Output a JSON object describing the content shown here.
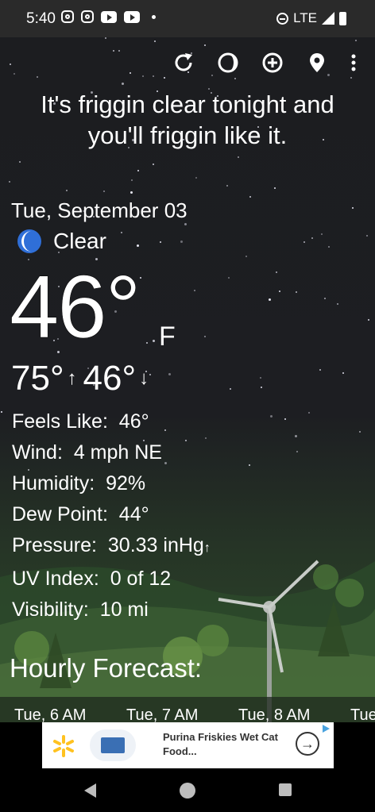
{
  "status_bar": {
    "time": "5:40",
    "network": "LTE",
    "left_icons": [
      "instagram-icon",
      "instagram-icon",
      "youtube-icon",
      "youtube-icon",
      "dot-icon"
    ],
    "right_icons": [
      "do-not-disturb-icon",
      "signal-icon",
      "battery-icon"
    ]
  },
  "toolbar": {
    "icons": [
      "refresh-icon",
      "moon-phase-icon",
      "add-location-icon",
      "location-pin-icon",
      "more-vert-icon"
    ]
  },
  "headline": {
    "line1": "It's friggin clear tonight and",
    "line2": "you'll friggin like it."
  },
  "current": {
    "date": "Tue, September 03",
    "condition": "Clear",
    "condition_icon": "moon-icon",
    "temperature": "46°",
    "unit": "F",
    "high": "75°",
    "low": "46°"
  },
  "details": [
    {
      "label": "Feels Like:",
      "value": "46°"
    },
    {
      "label": "Wind:",
      "value": "4 mph NE"
    },
    {
      "label": "Humidity:",
      "value": "92%"
    },
    {
      "label": "Dew Point:",
      "value": "44°"
    },
    {
      "label": "Pressure:",
      "value": "30.33 inHg"
    },
    {
      "label": "UV Index:",
      "value": "0 of 12"
    },
    {
      "label": "Visibility:",
      "value": "10 mi"
    }
  ],
  "hourly": {
    "title": "Hourly Forecast:",
    "hours": [
      "Tue, 6 AM",
      "Tue, 7 AM",
      "Tue, 8 AM",
      "Tue"
    ]
  },
  "ad": {
    "text": "Purina Friskies Wet Cat Food...",
    "brand_icon": "walmart-spark-icon",
    "arrow_icon": "arrow-right-icon",
    "colors": {
      "spark": "#ffc220",
      "box": "#3a6fb4"
    }
  },
  "nav": {
    "icons": [
      "back-icon",
      "home-icon",
      "recents-icon"
    ]
  }
}
